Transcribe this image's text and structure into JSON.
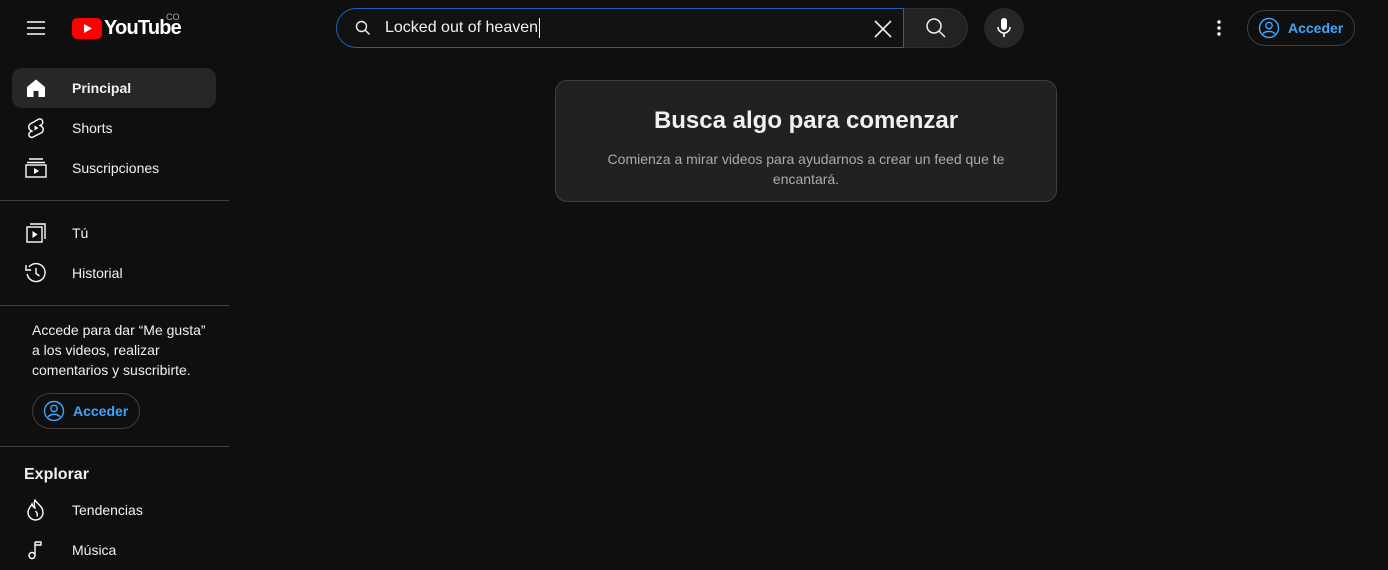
{
  "header": {
    "logo_text": "YouTube",
    "country_code": "CO",
    "search": {
      "value": "Locked out of heaven"
    },
    "signin_label": "Acceder"
  },
  "sidebar": {
    "items": [
      {
        "label": "Principal",
        "icon": "home-icon",
        "active": true
      },
      {
        "label": "Shorts",
        "icon": "shorts-icon"
      },
      {
        "label": "Suscripciones",
        "icon": "subscriptions-icon"
      },
      {
        "label": "Tú",
        "icon": "you-icon"
      },
      {
        "label": "Historial",
        "icon": "history-icon"
      }
    ],
    "signin_note": "Accede para dar “Me gusta” a los videos, realizar comentarios y suscribirte.",
    "signin_label": "Acceder",
    "explore_title": "Explorar",
    "explore_items": [
      {
        "label": "Tendencias",
        "icon": "trending-icon"
      },
      {
        "label": "Música",
        "icon": "music-icon"
      }
    ]
  },
  "main": {
    "empty_title": "Busca algo para comenzar",
    "empty_subtitle": "Comienza a mirar videos para ayudarnos a crear un feed que te encantará."
  },
  "colors": {
    "background": "#0f0f0f",
    "accent": "#3ea6ff",
    "brand_red": "#ff0000"
  }
}
